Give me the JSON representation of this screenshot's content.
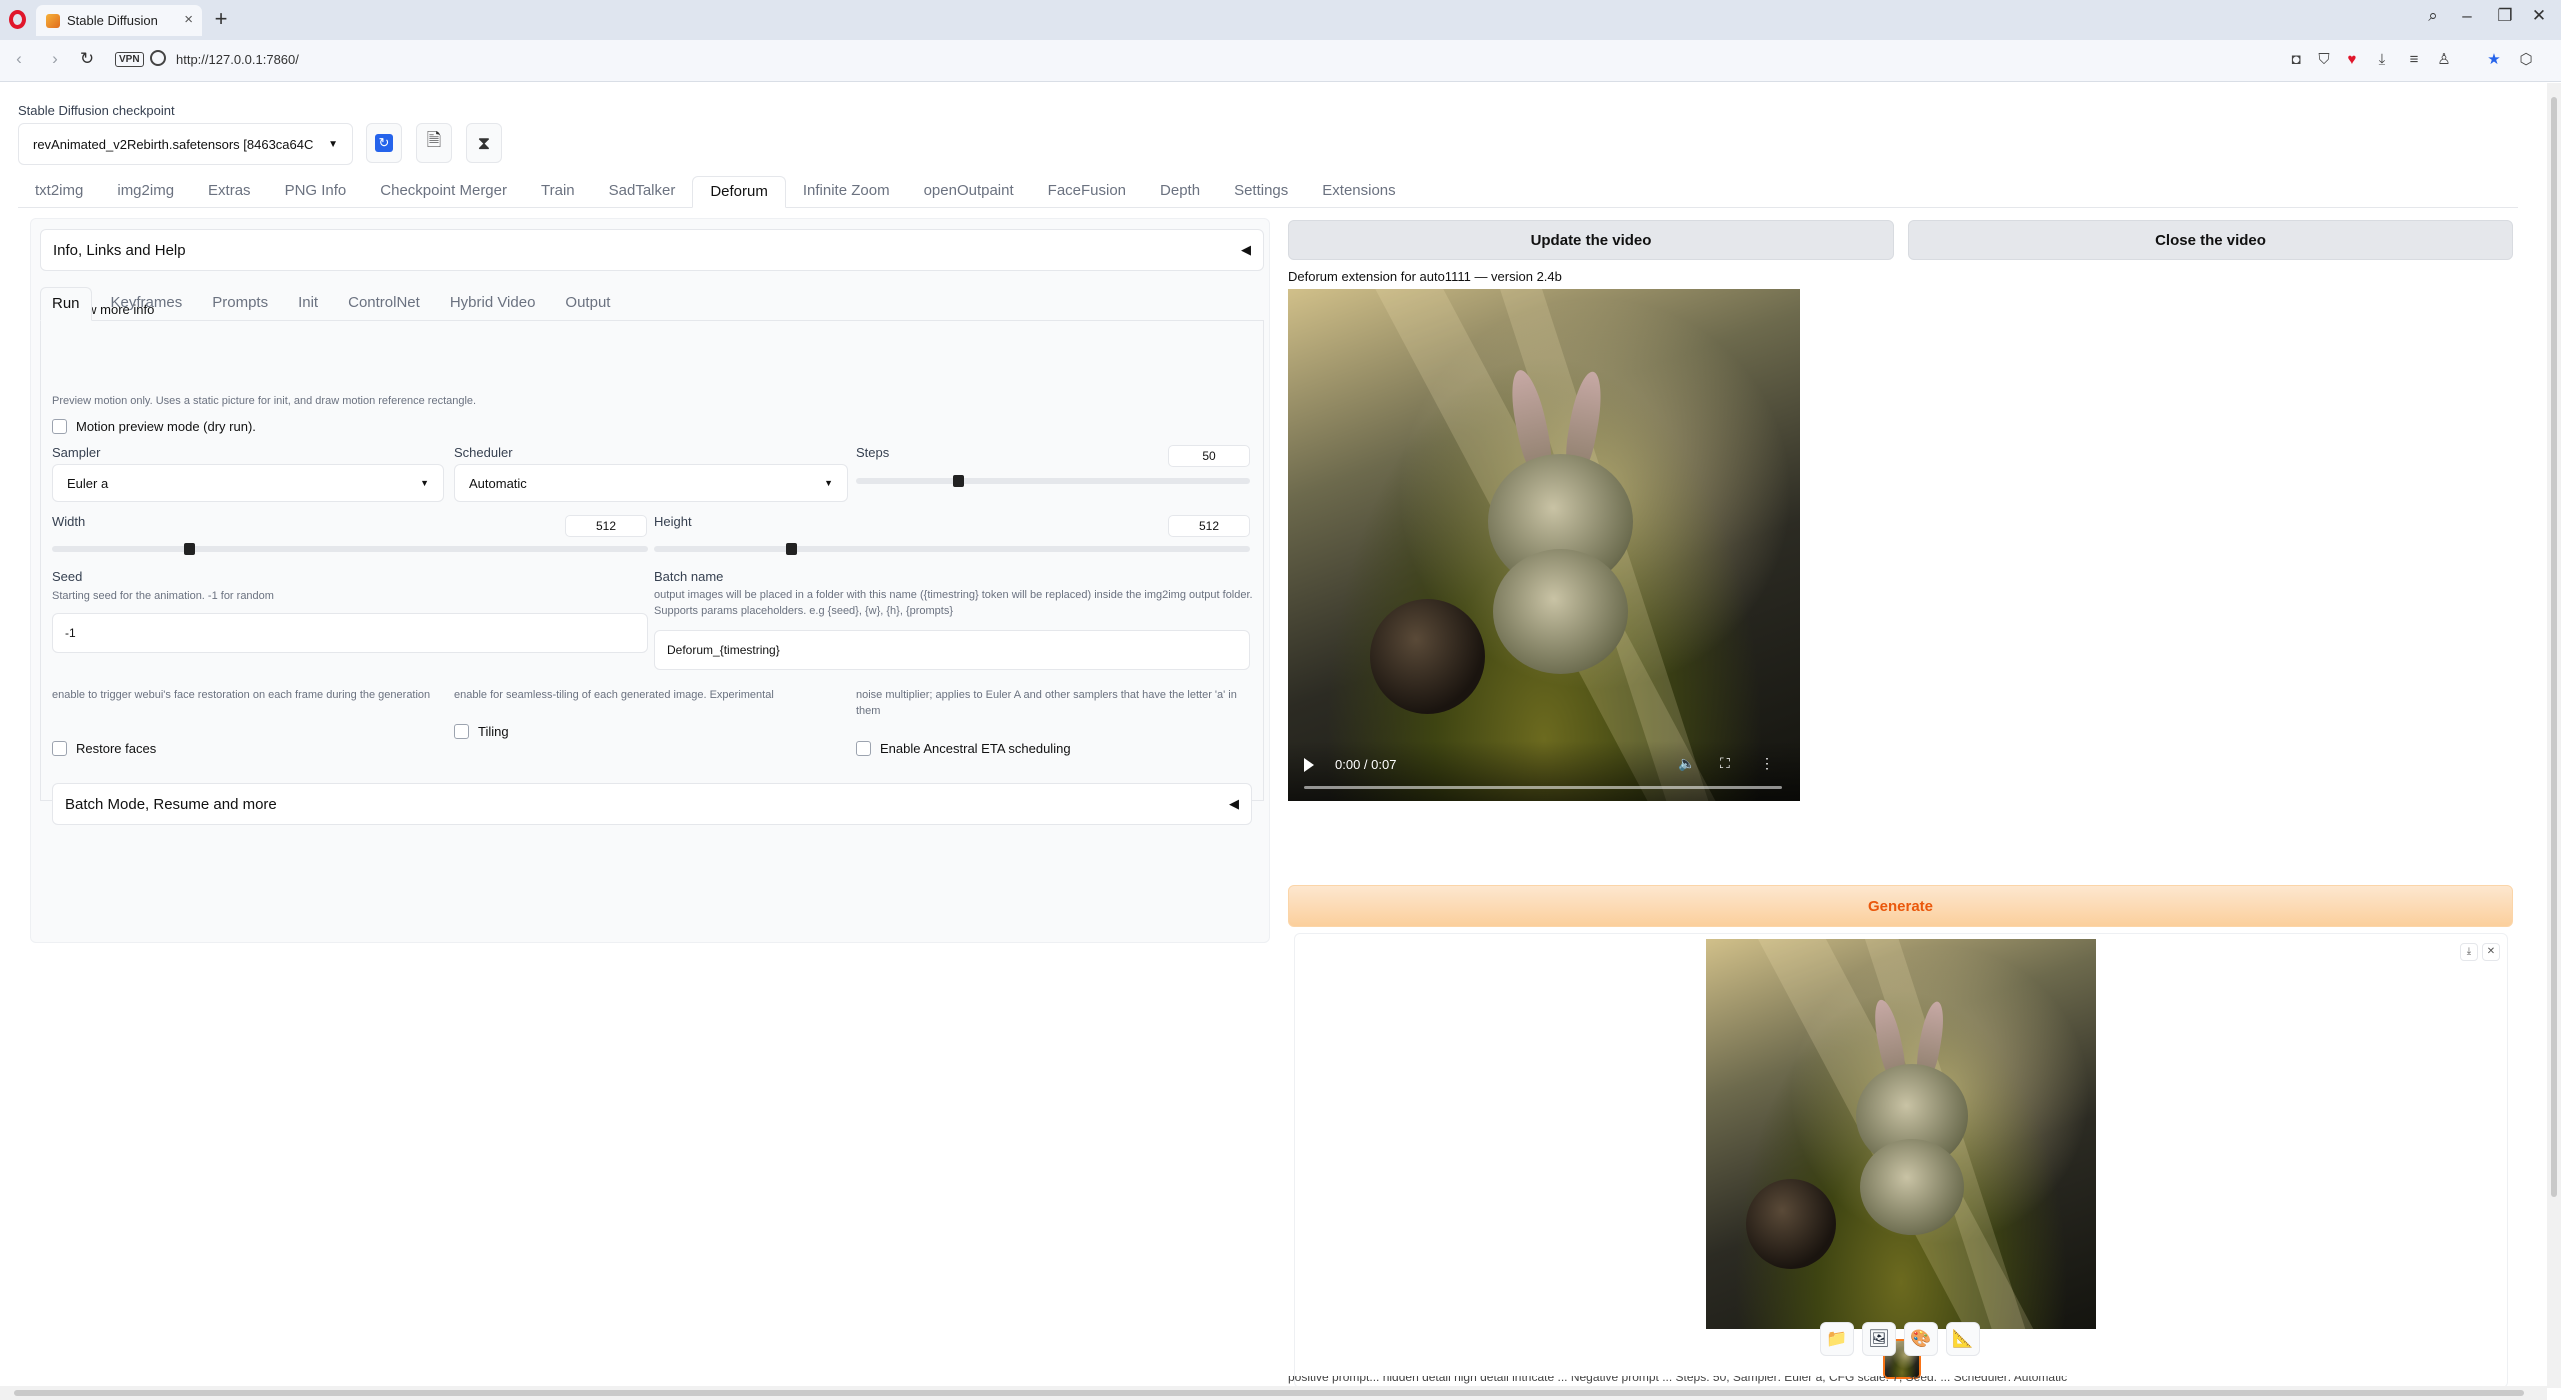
{
  "browser": {
    "tab_title": "Stable Diffusion",
    "new_tab": "+",
    "url": "http://127.0.0.1:7860/",
    "vpn_label": "VPN",
    "window_controls": [
      "⌕",
      "–",
      "❐",
      "✕"
    ],
    "toolbar_icons": [
      "camera-icon",
      "shield-icon",
      "heart-icon",
      "download-icon",
      "menu-icon",
      "profile-icon",
      "star-icon",
      "cube-icon"
    ]
  },
  "checkpoint": {
    "label": "Stable Diffusion checkpoint",
    "value": "revAnimated_v2Rebirth.safetensors [8463ca64C"
  },
  "main_tabs": [
    "txt2img",
    "img2img",
    "Extras",
    "PNG Info",
    "Checkpoint Merger",
    "Train",
    "SadTalker",
    "Deforum",
    "Infinite Zoom",
    "openOutpaint",
    "FaceFusion",
    "Depth",
    "Settings",
    "Extensions"
  ],
  "active_main_tab": "Deforum",
  "info_accordion": {
    "label": "Info, Links and Help",
    "arrow": "◀"
  },
  "show_more_info": {
    "label": "Show more info",
    "checked": true
  },
  "sub_tabs": [
    "Run",
    "Keyframes",
    "Prompts",
    "Init",
    "ControlNet",
    "Hybrid Video",
    "Output"
  ],
  "active_sub_tab": "Run",
  "run": {
    "preview_hint": "Preview motion only. Uses a static picture for init, and draw motion reference rectangle.",
    "preview_checkbox": "Motion preview mode (dry run).",
    "sampler": {
      "label": "Sampler",
      "value": "Euler a"
    },
    "scheduler": {
      "label": "Scheduler",
      "value": "Automatic"
    },
    "steps": {
      "label": "Steps",
      "value": "50",
      "fraction": 0.26
    },
    "width": {
      "label": "Width",
      "value": "512",
      "fraction": 0.23
    },
    "height": {
      "label": "Height",
      "value": "512",
      "fraction": 0.23
    },
    "seed": {
      "label": "Seed",
      "hint": "Starting seed for the animation. -1 for random",
      "value": "-1"
    },
    "batch_name": {
      "label": "Batch name",
      "hint": "output images will be placed in a folder with this name ({timestring} token will be replaced) inside the img2img output folder. Supports params placeholders. e.g {seed}, {w}, {h}, {prompts}",
      "value": "Deforum_{timestring}"
    },
    "restore_faces": {
      "hint": "enable to trigger webui's face restoration on each frame during the generation",
      "label": "Restore faces"
    },
    "tiling": {
      "hint": "enable for seamless-tiling of each generated image. Experimental",
      "label": "Tiling"
    },
    "ancestral_eta": {
      "hint": "noise multiplier; applies to Euler A and other samplers that have the letter 'a' in them",
      "label": "Enable Ancestral ETA scheduling"
    }
  },
  "batch_accordion": {
    "label": "Batch Mode, Resume and more",
    "arrow": "◀"
  },
  "video": {
    "update_button": "Update the video",
    "close_button": "Close the video",
    "version_text": "Deforum extension for auto1111 — version 2.4b",
    "time": "0:00 / 0:07"
  },
  "generate_button": "Generate",
  "gallery": {
    "download_label": "⤓",
    "close_label": "✕",
    "action_icons": [
      "folder-icon",
      "image-icon",
      "palette-icon",
      "ruler-icon"
    ]
  },
  "bottom_text": "positive prompt... hidden detail high detail intricate ... Negative prompt ... Steps: 50, Sampler: Euler a, CFG scale: 7, Seed: ... Scheduler: Automatic"
}
